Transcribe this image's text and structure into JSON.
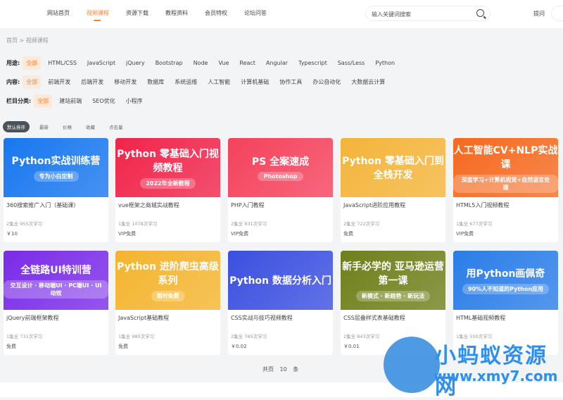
{
  "nav": {
    "items": [
      "网站首页",
      "视频课程",
      "资源下载",
      "教程资料",
      "会员特权",
      "论坛问答"
    ],
    "active": 1,
    "search_placeholder": "输入关键词搜索",
    "ask": "提问"
  },
  "breadcrumb": "首页 > 视频课程",
  "filters": [
    {
      "label": "用途:",
      "items": [
        "全部",
        "HTML/CSS",
        "JavaScript",
        "jQuery",
        "Bootstrap",
        "Node",
        "Vue",
        "React",
        "Angular",
        "Typescript",
        "Sass/Less",
        "Python"
      ]
    },
    {
      "label": "内容:",
      "items": [
        "全部",
        "前端开发",
        "后端开发",
        "移动开发",
        "数据库",
        "系统运维",
        "人工智能",
        "计算机基础",
        "协作工具",
        "办公自动化",
        "大数据云计算"
      ]
    },
    {
      "label": "栏目分类:",
      "items": [
        "全部",
        "建站前端",
        "SEO优化",
        "小程序"
      ]
    }
  ],
  "sort": [
    "默认排序",
    "最新",
    "价格",
    "收藏",
    "点击量"
  ],
  "courses": [
    {
      "banner": "Python实战训练营",
      "sub": "专为小白定制",
      "color": "#1877ef",
      "title": "360搜索推广入门（基础课）",
      "meta": "2集全 955次学习",
      "price": "￥10"
    },
    {
      "banner": "Python 零基础入门视频教程",
      "sub": "2022年全新教程",
      "color": "#f0244a",
      "title": "vue框架之商城实战教程",
      "meta": "1集全 1078次学习",
      "price": "VIP免费"
    },
    {
      "banner": "PS 全案速成",
      "sub": "Photoshop",
      "color": "#f5415c",
      "title": "PHP入门教程",
      "meta": "2集全 831次学习",
      "price": "VIP免费"
    },
    {
      "banner": "Python 零基础入门到全栈开发",
      "sub": "",
      "color": "#f4b43a",
      "title": "JavaScript进阶应用教程",
      "meta": "2集全 722次学习",
      "price": "免费"
    },
    {
      "banner": "人工智能CV+NLP实战课",
      "sub": "深度学习+计算机视觉+自然语言处理",
      "color": "#f5691f",
      "title": "HTML5入门视频教程",
      "meta": "1集全 677次学习",
      "price": "VIP免费"
    },
    {
      "banner": "全链路UI特训营",
      "sub": "交互设计 · 移动端UI · PC端UI · UI动效",
      "color": "#7a2be8",
      "title": "jQuery前端框架教程",
      "meta": "1集全 731次学习",
      "price": "免费"
    },
    {
      "banner": "Python 进阶爬虫高级系列",
      "sub": "限时免费",
      "color": "#f4b42e",
      "title": "JavaScript基础教程",
      "meta": "1集全 985次学习",
      "price": "免费"
    },
    {
      "banner": "Python 数据分析入门",
      "sub": "",
      "color": "#3a4fe0",
      "title": "CSS实战与技巧视频教程",
      "meta": "2集全 765次学习",
      "price": "￥0.02"
    },
    {
      "banner": "新手必学的 亚马逊运营 第一课",
      "sub": "新模式 · 新趋势 · 新玩法",
      "color": "#6f7f1a",
      "title": "CSS层叠样式表基础教程",
      "meta": "2集全 843次学习",
      "price": "￥0.01"
    },
    {
      "banner": "用Python画佩奇",
      "sub": "90%人不知道的Python应用",
      "color": "#2a7de8",
      "title": "HTML基础视频教程",
      "meta": "1集全 550次学习",
      "price": ""
    }
  ],
  "pager": "共页 10 条",
  "watermark": {
    "cn": "小蚂蚁资源网",
    "url": "www.xmy7.com"
  }
}
